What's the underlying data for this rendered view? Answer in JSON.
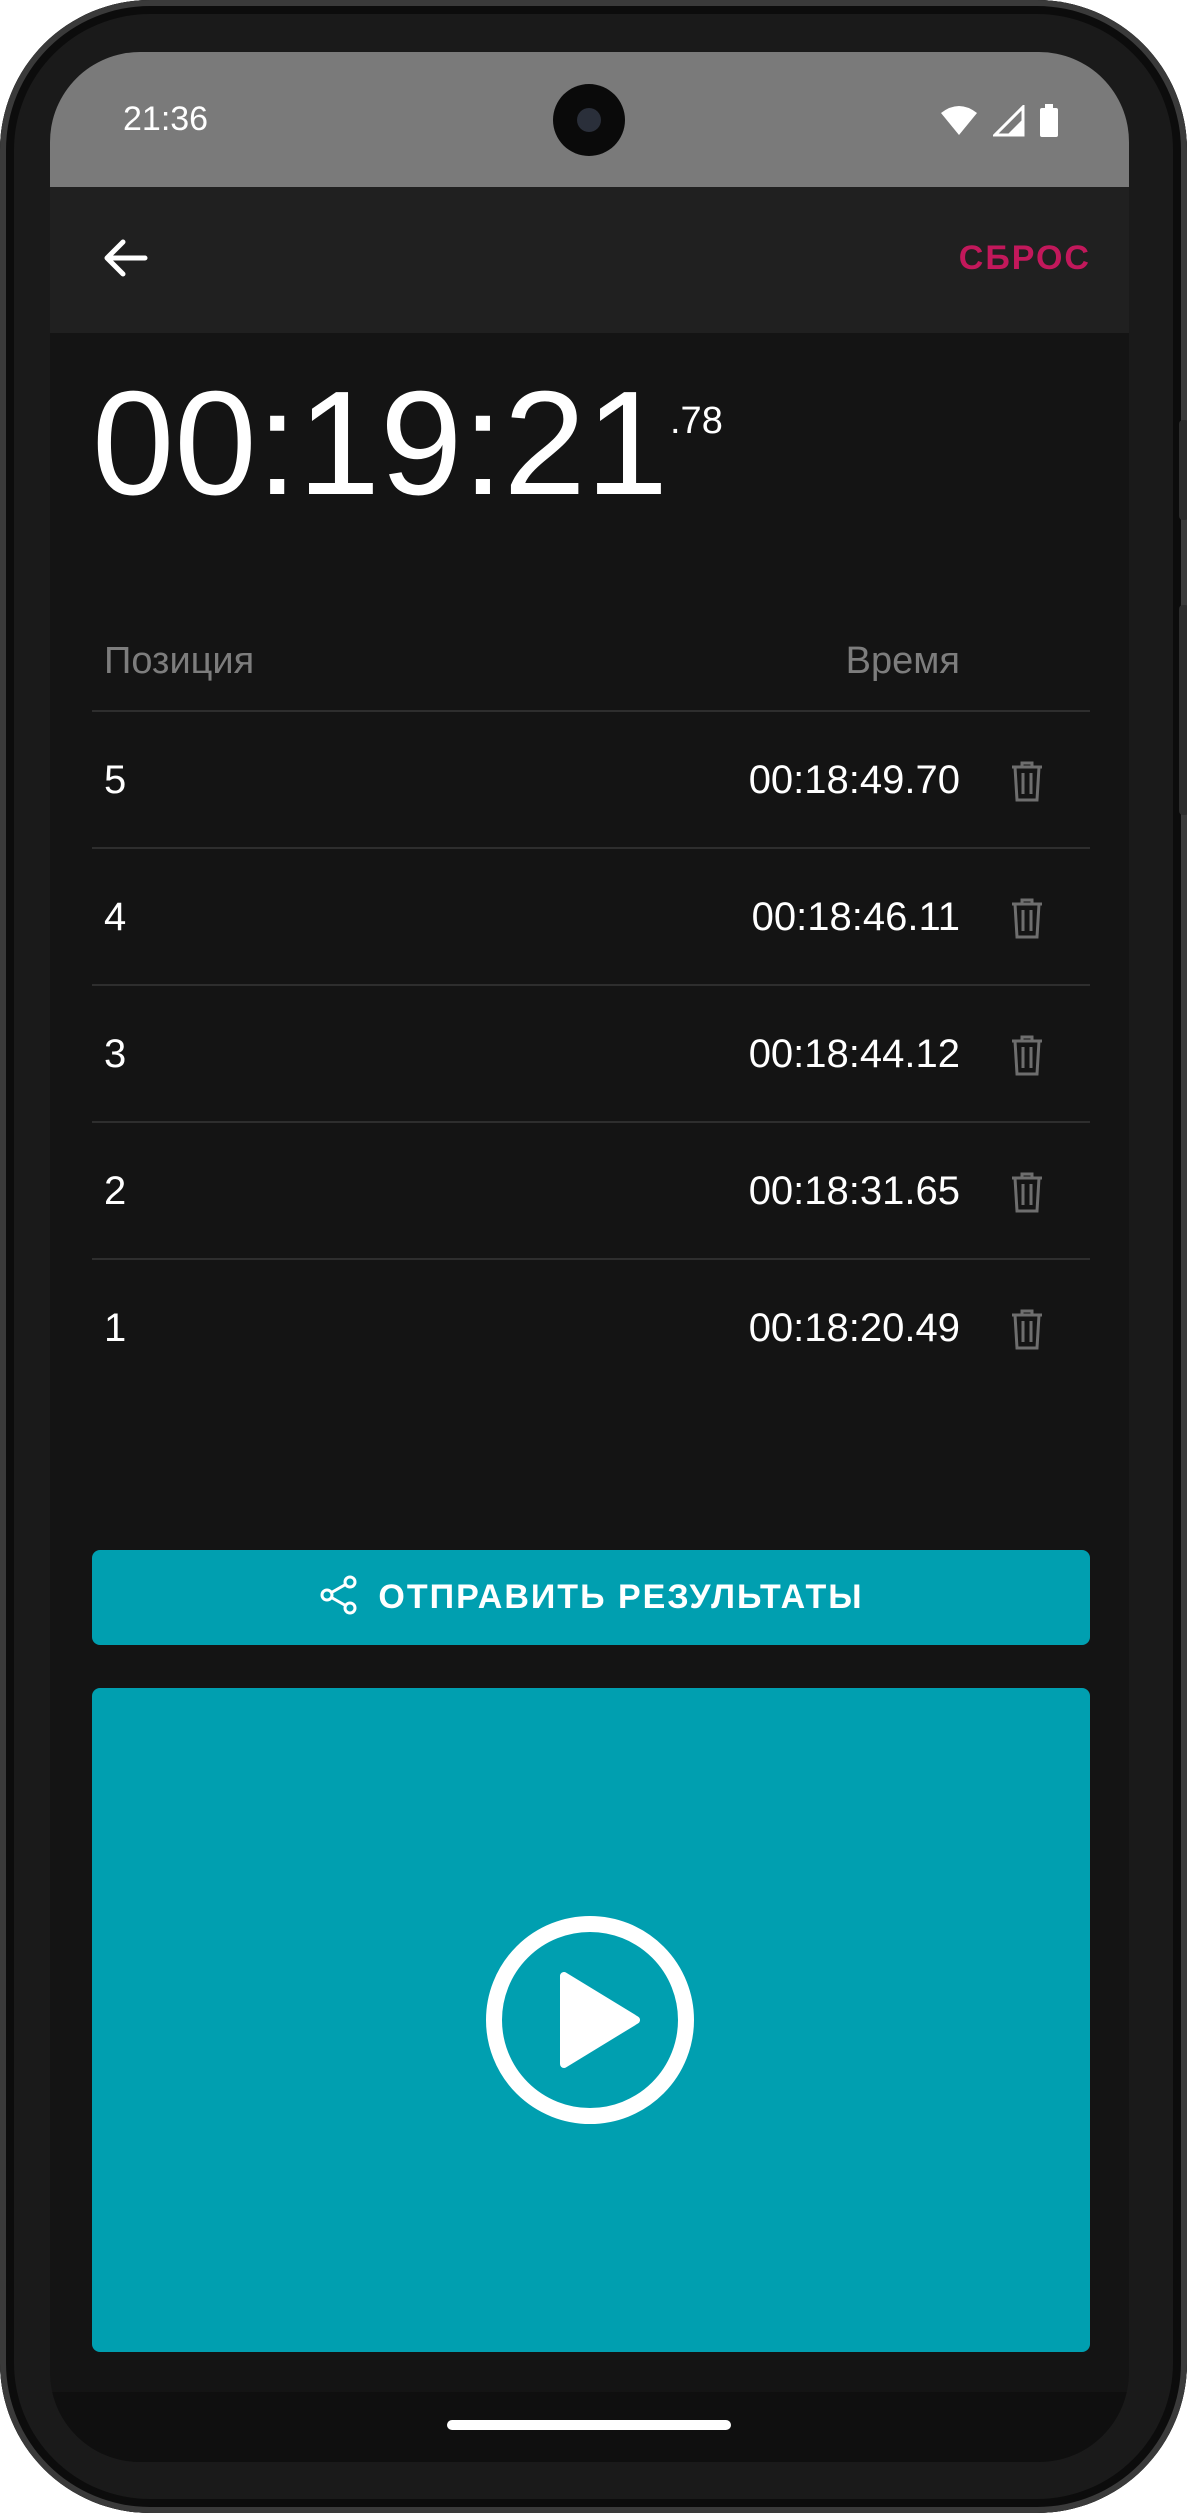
{
  "status_bar": {
    "time": "21:36",
    "icons": [
      "wifi-icon",
      "signal-icon",
      "battery-icon"
    ]
  },
  "app_bar": {
    "back_icon": "arrow-left-icon",
    "reset_label": "СБРОС"
  },
  "timer": {
    "main": "00:19:21",
    "fraction": ".78"
  },
  "table": {
    "headers": {
      "position": "Позиция",
      "time": "Время"
    },
    "rows": [
      {
        "position": "5",
        "time": "00:18:49.70"
      },
      {
        "position": "4",
        "time": "00:18:46.11"
      },
      {
        "position": "3",
        "time": "00:18:44.12"
      },
      {
        "position": "2",
        "time": "00:18:31.65"
      },
      {
        "position": "1",
        "time": "00:18:20.49"
      }
    ],
    "row_delete_icon": "trash-icon"
  },
  "share_button": {
    "label": "ОТПРАВИТЬ РЕЗУЛЬТАТЫ",
    "icon": "share-icon"
  },
  "play_button": {
    "icon": "play-circle-icon"
  },
  "colors": {
    "accent": "#009fb0",
    "reset": "#c2185b",
    "background": "#141414",
    "appbar": "#202020",
    "statusbar": "#7a7a7a"
  }
}
